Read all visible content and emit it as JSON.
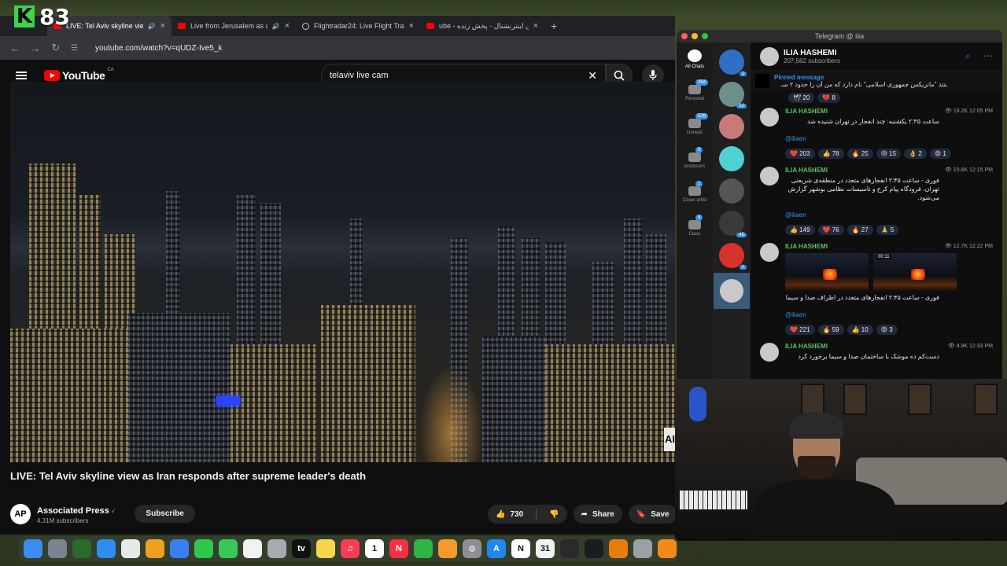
{
  "stream": {
    "brand_letter": "K",
    "viewer_count": "83"
  },
  "browser": {
    "tabs": [
      {
        "title": "LIVE: Tel Aviv skyline view",
        "active": true
      },
      {
        "title": "Live from Jerusalem as ai"
      },
      {
        "title": "Flightradar24: Live Flight Tra"
      },
      {
        "title": "ube - ایران اینترنشنال - پخش زنده"
      }
    ],
    "new_tab": "+",
    "url": "youtube.com/watch?v=qUDZ-Ive5_k"
  },
  "youtube": {
    "logo_text": "YouTube",
    "region": "CA",
    "search_value": "telaviv live cam",
    "video_title": "LIVE: Tel Aviv skyline view as Iran responds after supreme leader's death",
    "channel": {
      "avatar_text": "AP",
      "name": "Associated Press",
      "verified_icon": "✓",
      "subscribers": "4.31M subscribers"
    },
    "subscribe_label": "Subscribe",
    "likes": "730",
    "share_label": "Share",
    "save_label": "Save",
    "watermark": "AI"
  },
  "telegram": {
    "window_title": "Telegram @ ilia",
    "folders": [
      {
        "label": "All Chats",
        "badge": ""
      },
      {
        "label": "Personal",
        "badge": "394"
      },
      {
        "label": "Unread",
        "badge": "529"
      },
      {
        "label": "producers",
        "badge": "3"
      },
      {
        "label": "Cover artist",
        "badge": "1"
      },
      {
        "label": "Class",
        "badge": "4"
      }
    ],
    "chatlist_badges": [
      "1",
      "12",
      "",
      "",
      "",
      "45",
      "1",
      ""
    ],
    "channel_name": "ILIA HASHEMI",
    "channel_subs": "207,562 subscribers",
    "pinned_title": "Pinned message",
    "pinned_text": "بتتد \"ماتریکس جمهوری اسلامی\" نام دارد که من آن را حدود ۲ سـ",
    "pinned_reactions": [
      "🕊 20",
      "💔 8"
    ],
    "posts": [
      {
        "author": "ILIA HASHEMI",
        "meta": "👁 18.2K 12:05 PM",
        "text": "ساعت ۲:۳۵ یکشنبه: چند انفجار در تهران شنیده شد",
        "link": "@iliaen",
        "reactions": [
          "❤️ 203",
          "👍 78",
          "🔥 25",
          "😢 15",
          "👌 2",
          "😡 1"
        ]
      },
      {
        "author": "ILIA HASHEMI",
        "meta": "👁 15.6K 12:15 PM",
        "text": "فوری - ساعت ۲:۴۵ انفجارهای متعدد در منطقه‌ی شریعتی تهران، فرودگاه پیام کرج و تاسیسات نظامی بوشهر گزارش می‌شود.",
        "link": "@iliaen",
        "reactions": [
          "👍 149",
          "❤️ 76",
          "🔥 27",
          "🙏 5"
        ]
      },
      {
        "author": "ILIA HASHEMI",
        "meta": "👁 12.7K 12:22 PM",
        "video_duration": "00:11",
        "text": "فوری - ساعت ۲:۴۵ انفجارهای متعدد در اطراف صدا و سیما",
        "link": "@iliaen",
        "reactions": [
          "❤️ 221",
          "🔥 59",
          "👍 10",
          "😡 3"
        ]
      },
      {
        "author": "ILIA HASHEMI",
        "meta": "👁 4.9K 12:33 PM",
        "text": "دست‌کم ده موشک با ساختمان صدا و سیما برخورد کرد",
        "link": "",
        "reactions": []
      }
    ]
  },
  "dock": {
    "icons": [
      "finder-icon",
      "launchpad-icon",
      "app-icon",
      "safari-icon",
      "chrome-icon",
      "photos-icon",
      "mail-icon",
      "facetime-icon",
      "messages-icon",
      "freeform-icon",
      "preview-icon",
      "apple-tv-icon",
      "notes-icon",
      "music-icon",
      "calendar-icon",
      "news-icon",
      "numbers-icon",
      "pages-icon",
      "settings-icon",
      "app-store-icon",
      "notion-icon",
      "cal-icon",
      "obs-icon",
      "app2-icon",
      "blender-icon",
      "system-icon",
      "garageband-icon"
    ],
    "labels": [
      "",
      "",
      "",
      "",
      "",
      "",
      "",
      "",
      "",
      "",
      "",
      "tv",
      "",
      "♫",
      "1",
      "N",
      "",
      "",
      "⚙",
      "A",
      "N",
      "31",
      "",
      "",
      "",
      "",
      ""
    ],
    "colors": [
      "#3b8cf0",
      "#7b8390",
      "#2a6a2a",
      "#2f8cf0",
      "#e8e8e8",
      "#f0a020",
      "#3a7ef0",
      "#2cc84a",
      "#38c859",
      "#f2f2f2",
      "#a8aab0",
      "#111111",
      "#f7d54a",
      "#fa3c54",
      "#ffffff",
      "#fa3042",
      "#2fb344",
      "#f29a2a",
      "#8e8e93",
      "#1e88f0",
      "#ffffff",
      "#f2f2f2",
      "#2a2a2a",
      "#1c1c1e",
      "#e87d0d",
      "#9aa0a6",
      "#f28a1a"
    ]
  }
}
